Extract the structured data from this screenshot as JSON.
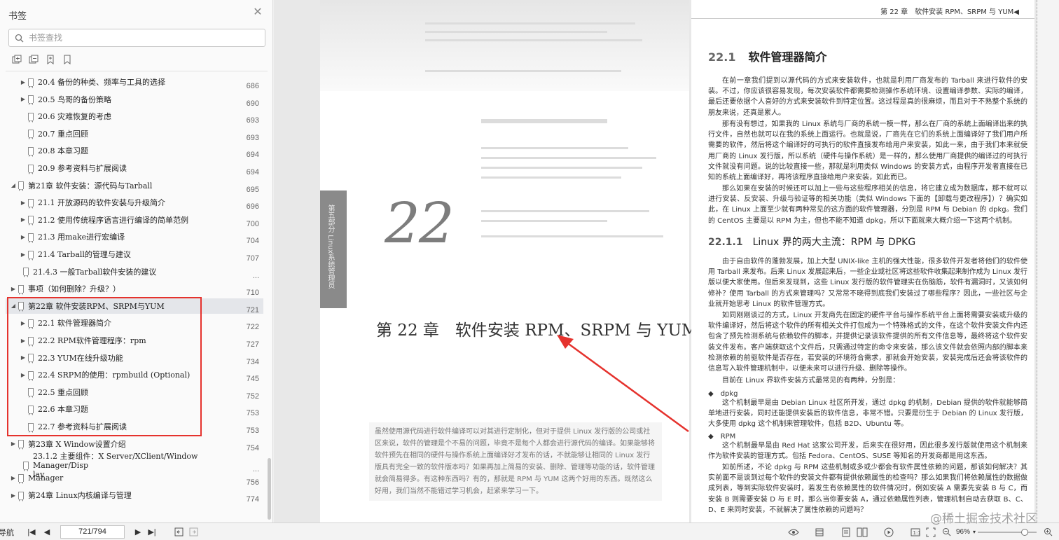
{
  "sidebar": {
    "title": "书签",
    "search_placeholder": "书签查找",
    "tools": [
      "expand-all-icon",
      "collapse-all-icon",
      "add-bookmark-icon",
      "bookmark-icon"
    ],
    "items": [
      {
        "label": "20.4 备份的种类、频率与工具的选择",
        "page": "686",
        "indent": 1,
        "expand": "▶"
      },
      {
        "label": "20.5 鸟哥的备份策略",
        "page": "690",
        "indent": 1,
        "expand": "▶"
      },
      {
        "label": "20.6 灾难恢复的考虑",
        "page": "693",
        "indent": 1,
        "expand": ""
      },
      {
        "label": "20.7 重点回顾",
        "page": "693",
        "indent": 1,
        "expand": ""
      },
      {
        "label": "20.8 本章习题",
        "page": "694",
        "indent": 1,
        "expand": ""
      },
      {
        "label": "20.9 参考资料与扩展阅读",
        "page": "694",
        "indent": 1,
        "expand": ""
      },
      {
        "label": "第21章 软件安装：源代码与Tarball",
        "page": "695",
        "indent": 0,
        "expand": "◢"
      },
      {
        "label": "21.1 开放源码的软件安装与升级简介",
        "page": "696",
        "indent": 1,
        "expand": "▶"
      },
      {
        "label": "21.2 使用传统程序语言进行编译的简单范例",
        "page": "700",
        "indent": 1,
        "expand": "▶"
      },
      {
        "label": "21.3 用make进行宏编译",
        "page": "704",
        "indent": 1,
        "expand": "▶"
      },
      {
        "label": "21.4 Tarball的管理与建议",
        "page": "707",
        "indent": 1,
        "expand": "▶"
      },
      {
        "label": "21.4.3 一般Tarball软件安装的建议",
        "page": "...",
        "indent": 0.5,
        "expand": ""
      },
      {
        "label": "事项（如何删除？升级？）",
        "page": "710",
        "indent": 0,
        "expand": "▶"
      },
      {
        "label": "第22章 软件安装RPM、SRPM与YUM",
        "page": "721",
        "indent": 0,
        "expand": "◢",
        "selected": true
      },
      {
        "label": "22.1 软件管理器简介",
        "page": "722",
        "indent": 1,
        "expand": "▶"
      },
      {
        "label": "22.2 RPM软件管理程序：rpm",
        "page": "727",
        "indent": 1,
        "expand": "▶"
      },
      {
        "label": "22.3 YUM在线升级功能",
        "page": "734",
        "indent": 1,
        "expand": "▶"
      },
      {
        "label": "22.4 SRPM的使用：rpmbuild (Optional)",
        "page": "745",
        "indent": 1,
        "expand": "▶"
      },
      {
        "label": "22.5 重点回顾",
        "page": "752",
        "indent": 1,
        "expand": ""
      },
      {
        "label": "22.6 本章习题",
        "page": "753",
        "indent": 1,
        "expand": ""
      },
      {
        "label": "22.7 参考资料与扩展阅读",
        "page": "753",
        "indent": 1,
        "expand": ""
      },
      {
        "label": "第23章 X Window设置介绍",
        "page": "754",
        "indent": 0,
        "expand": "▶"
      },
      {
        "label": "23.1.2 主要组件：X Server/XClient/Window Manager/Disp",
        "label2": "lay",
        "page": "...",
        "indent": 0.5,
        "expand": ""
      },
      {
        "label": "Manager",
        "page": "756",
        "indent": 0,
        "expand": "▶"
      },
      {
        "label": "第24章 Linux内核编译与管理",
        "page": "774",
        "indent": 0,
        "expand": "▶"
      }
    ]
  },
  "document": {
    "left_page": {
      "side_tab": "第五部分 Linux系统管理员",
      "chapter_number": "22",
      "chapter_title": "第 22 章　软件安装 RPM、SRPM 与 YUM",
      "intro": "虽然使用源代码进行软件编译可以对其进行定制化，但对于提供 Linux 发行版的公司或社区来说，软件的管理是个不易的问题，毕竟不是每个人都会进行源代码的编译。如果能够将软件预先在相同的硬件与操作系统上面编译好才发布的话，不就能够让相同的 Linux 发行版具有完全一致的软件版本吗？如果再加上简易的安装、删除、管理等功能的话，软件管理就会简易得多。有这种东西吗？有的，那就是 RPM 与 YUM 这两个好用的东西。既然这么好用，我们当然不能错过学习机会，赶紧来学习一下。"
    },
    "right_page": {
      "running_head": "第 22 章　软件安装 RPM、SRPM 与 YUM◀",
      "h1_num": "22.1",
      "h1_text": "软件管理器简介",
      "p1": "在前一章我们提到以源代码的方式来安装软件，也就是利用厂商发布的 Tarball 来进行软件的安装。不过，你应该很容易发现，每次安装软件都需要检测操作系统环境、设置编译参数、实际的编译，最后还要依据个人喜好的方式来安装软件到特定位置。这过程是真的很麻烦，而且对于不熟整个系统的朋友来说，还真是累人。",
      "p2": "那有没有想过，如果我的 Linux 系统与厂商的系统一模一样，那么在厂商的系统上面编译出来的执行文件，自然也就可以在我的系统上面运行。也就是说，厂商先在它们的系统上面编译好了我们用户所需要的软件，然后将这个编译好的可执行的软件直接发布给用户来安装，如此一来，由于我们本来就使用厂商的 Linux 发行版，所以系统（硬件与操作系统）是一样的，那么使用厂商提供的编译过的可执行文件就没有问题。说的比较直接一些，那就是利用类似 Windows 的安装方式，由程序开发者直接在已知的系统上面编译好，再将该程序直接给用户来安装，如此而已。",
      "p3": "那么如果在安装的时候还可以加上一些与这些程序相关的信息，将它建立成为数据库，那不就可以进行安装、反安装、升级与验证等的相关功能（类似 Windows 下面的【卸载与更改程序】）？确实如此，在 Linux 上面至少就有两种常见的这方面的软件管理器，分别是 RPM 与 Debian 的 dpkg。我们的 CentOS 主要是以 RPM 为主，但也不能不知道 dpkg，所以下面就来大概介绍一下这两个机制。",
      "h2_num": "22.1.1",
      "h2_text": "Linux 界的两大主流：RPM 与 DPKG",
      "p4": "由于自由软件的蓬勃发展，加上大型 UNIX-like 主机的强大性能，很多软件开发者将他们的软件使用 Tarball 来发布。后来 Linux 发展起来后，一些企业或社区将这些软件收集起来制作成为 Linux 发行版以便大家使用。但后来发现到，这些 Linux 发行版的软件管理实在伤脑筋，软件有漏洞时，又该如何修补？使用 Tarball 的方式来管理吗？又常常不晓得到底我们安装过了哪些程序？因此，一些社区与企业就开始思考 Linux 的软件管理方式。",
      "p5": "如同刚刚谈过的方式，Linux 开发商先在固定的硬件平台与操作系统平台上面将需要安装或升级的软件编译好，然后将这个软件的所有相关文件打包成为一个特殊格式的文件，在这个软件安装文件内还包含了预先检测系统与依赖软件的脚本，并提供记录该软件提供的所有文件信息等，最终将这个软件安装文件发布。客户端获取这个文件后，只需通过特定的命令来安装，那么该文件就会依照内部的脚本来检测依赖的前驱软件是否存在，若安装的环境符合需求，那就会开始安装，安装完成后还会将该软件的信息写入软件管理机制中，以便未来可以进行升级、删除等操作。",
      "p6": "目前在 Linux 界软件安装方式最常见的有两种，分别是：",
      "b1": "◆　dpkg",
      "p7": "这个机制最早是由 Debian Linux 社区所开发，通过 dpkg 的机制，Debian 提供的软件就能够简单地进行安装，同时还能提供安装后的软件信息，非常不错。只要是衍生于 Debian 的 Linux 发行版，大多使用 dpkg 这个机制来管理软件，包括 B2D、Ubuntu 等。",
      "b2": "◆　RPM",
      "p8": "这个机制最早是由 Red Hat 这家公司开发，后来实在很好用，因此很多发行版就使用这个机制来作为软件安装的管理方式。包括 Fedora、CentOS、SUSE 等知名的开发商都是用这东西。",
      "p9": "如前所述，不论 dpkg 与 RPM 这些机制或多或少都会有软件属性依赖的问题，那该如何解决？其实前面不是谈到过每个软件的安装文件都有提供依赖属性的检查吗？那么如果我们将依赖属性的数据做成列表，等到实际软件安装时，若发生有依赖属性的软件情况时，例如安装 A 需要先安装 B 与 C，而安装 B 则需要安装 D 与 E 时，那么当你要安装 A，通过依赖属性列表，管理机制自动去获取 B、C、D、E 来同时安装，不就解决了属性依赖的问题吗？"
    }
  },
  "statusbar": {
    "nav_label": "导航",
    "page_indicator": "721/794",
    "zoom": "96%",
    "zoom_level": 0.8
  },
  "watermark": "@稀土掘金技术社区",
  "colors": {
    "annotation": "#e5322d",
    "selected_row": "#e4e6ea"
  }
}
